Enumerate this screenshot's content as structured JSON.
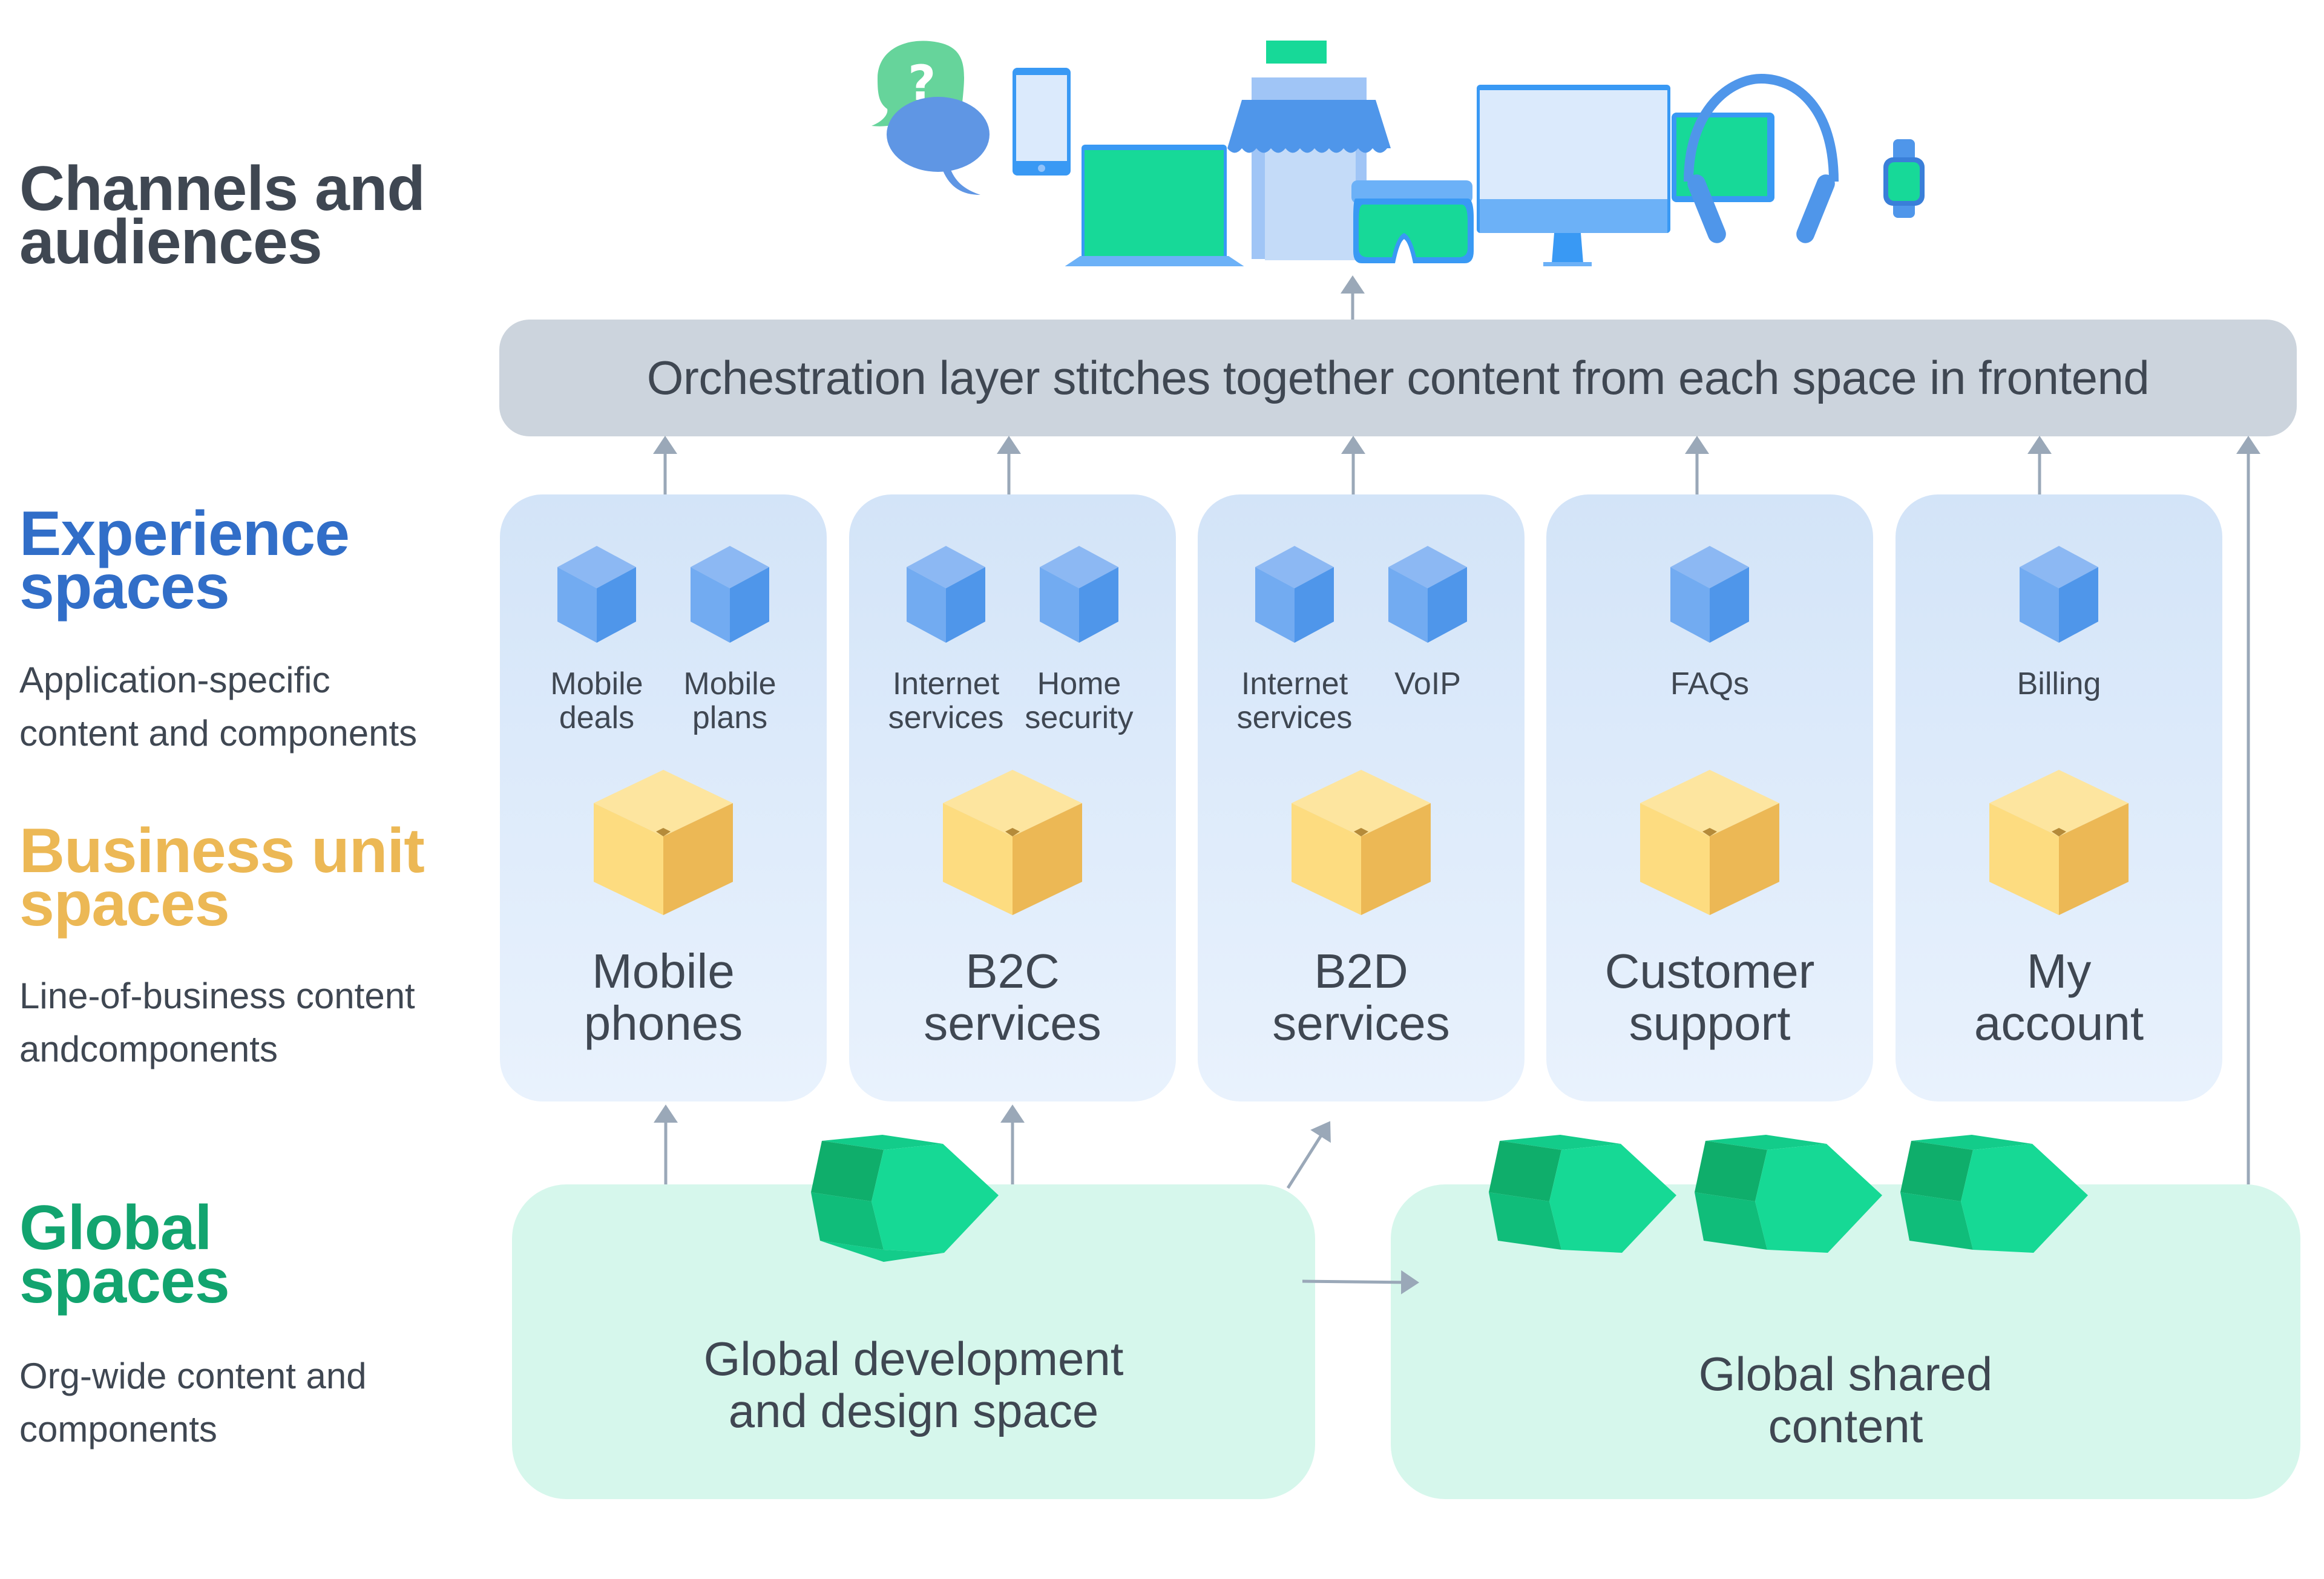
{
  "colors": {
    "heading_dark": "#3f4752",
    "experience_blue": "#316ec8",
    "business_yellow": "#ecb855",
    "global_green": "#12a46f",
    "orchestration_bg": "#ccd4dd",
    "experience_col_bg": "#d9e8fa",
    "global_bg": "#d6f7ec",
    "arrow": "#9aa8b8"
  },
  "sections": {
    "channels": {
      "title": "Channels and\naudiences"
    },
    "experience": {
      "title": "Experience\nspaces",
      "description": "Application-specific\ncontent and components"
    },
    "business": {
      "title": "Business unit\nspaces",
      "description": "Line-of-business content\nandcomponents"
    },
    "global": {
      "title": "Global\nspaces",
      "description": "Org-wide content and\ncomponents"
    }
  },
  "channels_icons": [
    "chat-bubbles-icon",
    "smartphone-icon",
    "laptop-icon",
    "storefront-icon",
    "vr-headset-icon",
    "desktop-monitor-icon",
    "tablet-icon",
    "headphones-icon",
    "smartwatch-icon"
  ],
  "orchestration": {
    "label": "Orchestration layer stitches together content from each space in frontend"
  },
  "columns": [
    {
      "experience_items": [
        "Mobile\ndeals",
        "Mobile\nplans"
      ],
      "business_unit": "Mobile\nphones"
    },
    {
      "experience_items": [
        "Internet\nservices",
        "Home\nsecurity"
      ],
      "business_unit": "B2C\nservices"
    },
    {
      "experience_items": [
        "Internet\nservices",
        "VoIP"
      ],
      "business_unit": "B2D\nservices"
    },
    {
      "experience_items": [
        "FAQs"
      ],
      "business_unit": "Customer\nsupport"
    },
    {
      "experience_items": [
        "Billing"
      ],
      "business_unit": "My\naccount"
    }
  ],
  "global_spaces": [
    {
      "label": "Global development\nand design space",
      "icon_count": 1
    },
    {
      "label": "Global shared\ncontent",
      "icon_count": 3
    }
  ]
}
